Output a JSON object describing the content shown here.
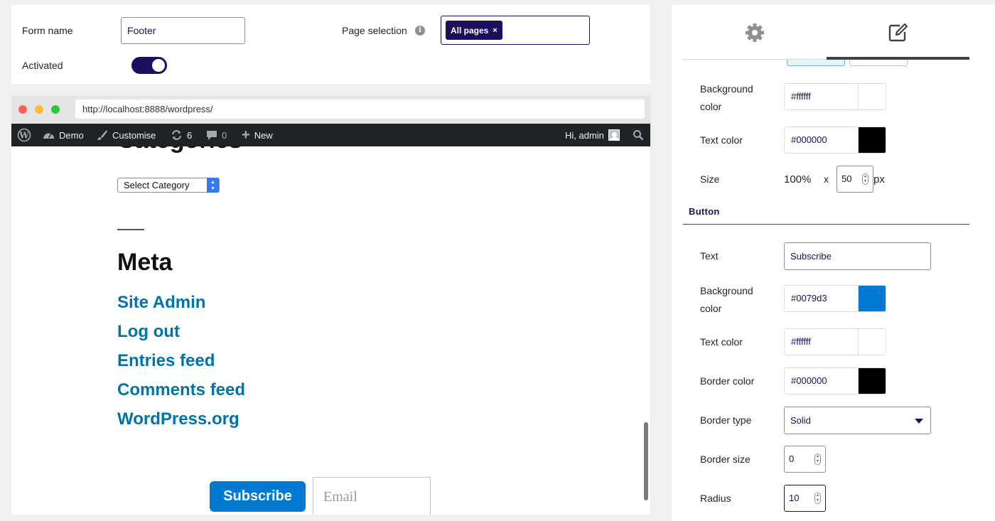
{
  "form": {
    "form_name_label": "Form name",
    "form_name_value": "Footer",
    "page_selection_label": "Page selection",
    "page_chip": "All pages",
    "chip_remove": "×",
    "activated_label": "Activated",
    "activated": true
  },
  "browser": {
    "url": "http://localhost:8888/wordpress/",
    "dot_colors": [
      "#ff5f57",
      "#febc2e",
      "#28c840"
    ]
  },
  "adminbar": {
    "site": "Demo",
    "customise": "Customise",
    "updates_count": "6",
    "comments_count": "0",
    "new": "New",
    "greeting": "Hi, admin"
  },
  "site": {
    "cut_heading": "Categories",
    "category_select": "Select Category",
    "meta_title": "Meta",
    "links": [
      "Site Admin",
      "Log out",
      "Entries feed",
      "Comments feed",
      "WordPress.org"
    ],
    "subscribe_button": "Subscribe",
    "email_placeholder": "Email"
  },
  "panel": {
    "tabs": [
      {
        "icon": "gear-icon",
        "active": false
      },
      {
        "icon": "edit-icon",
        "active": true
      }
    ],
    "form_section": {
      "background_color_label": "Background color",
      "background_color": "#ffffff",
      "text_color_label": "Text color",
      "text_color": "#000000",
      "size_label": "Size",
      "size_width": "100%",
      "size_x": "x",
      "size_height": "50",
      "size_unit": "px"
    },
    "button_section": {
      "title": "Button",
      "text_label": "Text",
      "text_value": "Subscribe",
      "background_color_label": "Background color",
      "background_color": "#0079d3",
      "text_color_label": "Text color",
      "text_color": "#ffffff",
      "border_color_label": "Border color",
      "border_color": "#000000",
      "border_type_label": "Border type",
      "border_type": "Solid",
      "border_size_label": "Border size",
      "border_size": "0",
      "radius_label": "Radius",
      "radius": "10"
    }
  },
  "colors": {
    "accent": "#1b0f5e",
    "link": "#0073aa",
    "button": "#0079d3",
    "adminbar": "#1d2327"
  }
}
